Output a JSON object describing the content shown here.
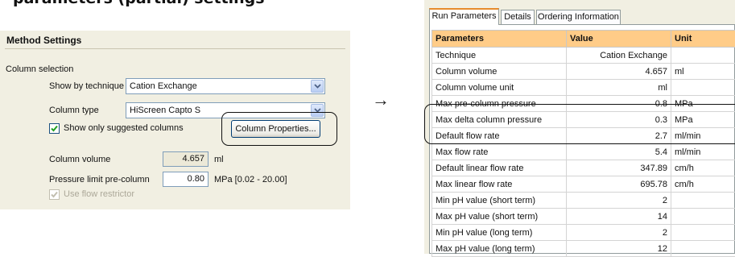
{
  "heading": "parameters (partial) settings",
  "method_settings": {
    "title": "Method Settings",
    "column_selection": "Column selection",
    "show_by_technique_label": "Show by technique",
    "show_by_technique_value": "Cation Exchange",
    "column_type_label": "Column type",
    "column_type_value": "HiScreen Capto S",
    "show_only_suggested": "Show only suggested columns",
    "column_properties_button": "Column Properties...",
    "column_volume_label": "Column volume",
    "column_volume_value": "4.657",
    "column_volume_unit": "ml",
    "pressure_limit_label": "Pressure limit pre-column",
    "pressure_limit_value": "0.80",
    "pressure_limit_unit": "MPa [0.02 - 20.00]",
    "use_flow_restrictor": "Use flow restrictor"
  },
  "arrow": "→",
  "dialog": {
    "tabs": [
      {
        "label": "Run Parameters",
        "active": true
      },
      {
        "label": "Details",
        "active": false
      },
      {
        "label": "Ordering Information",
        "active": false
      }
    ],
    "columns": [
      "Parameters",
      "Value",
      "Unit"
    ],
    "rows": [
      {
        "param": "Technique",
        "value": "Cation Exchange",
        "unit": ""
      },
      {
        "param": "Column volume",
        "value": "4.657",
        "unit": "ml"
      },
      {
        "param": "Column volume unit",
        "value": "ml",
        "unit": ""
      },
      {
        "param": "Max pre-column pressure",
        "value": "0.8",
        "unit": "MPa"
      },
      {
        "param": "Max delta column pressure",
        "value": "0.3",
        "unit": "MPa"
      },
      {
        "param": "Default flow rate",
        "value": "2.7",
        "unit": "ml/min"
      },
      {
        "param": "Max flow rate",
        "value": "5.4",
        "unit": "ml/min"
      },
      {
        "param": "Default linear flow rate",
        "value": "347.89",
        "unit": "cm/h"
      },
      {
        "param": "Max linear flow rate",
        "value": "695.78",
        "unit": "cm/h"
      },
      {
        "param": "Min pH value (short term)",
        "value": "2",
        "unit": ""
      },
      {
        "param": "Max pH value (short term)",
        "value": "14",
        "unit": ""
      },
      {
        "param": "Min pH value (long term)",
        "value": "2",
        "unit": ""
      },
      {
        "param": "Max pH value (long term)",
        "value": "12",
        "unit": ""
      }
    ]
  }
}
